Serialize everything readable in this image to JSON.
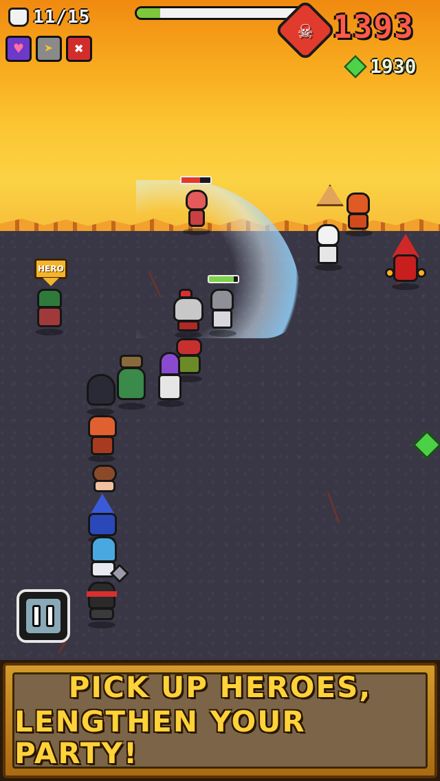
{
  "hud": {
    "party_count": "11/15",
    "party_icon": "fist-icon",
    "powerups": [
      {
        "name": "heart-powerup-icon",
        "glyph": "♥"
      },
      {
        "name": "winged-boot-powerup-icon",
        "glyph": "➤"
      },
      {
        "name": "bomb-powerup-icon",
        "glyph": "✖"
      }
    ],
    "xp_progress": 0.14,
    "kill_icon": "skull-icon",
    "kill_count": "1393",
    "gem_icon": "gem-icon",
    "gem_count": "1930"
  },
  "hero_tag": "HERO",
  "enemy_hp": [
    0.65,
    0.85
  ],
  "pause_icon": "pause-icon",
  "banner": {
    "line1": "Pick up heroes,",
    "line2": "lengthen your party!"
  },
  "colors": {
    "kill_count": "#ff5a4a",
    "gem": "#4fd14a",
    "banner_text": "#ffd23a",
    "xp_fill": "#7ec83a"
  }
}
